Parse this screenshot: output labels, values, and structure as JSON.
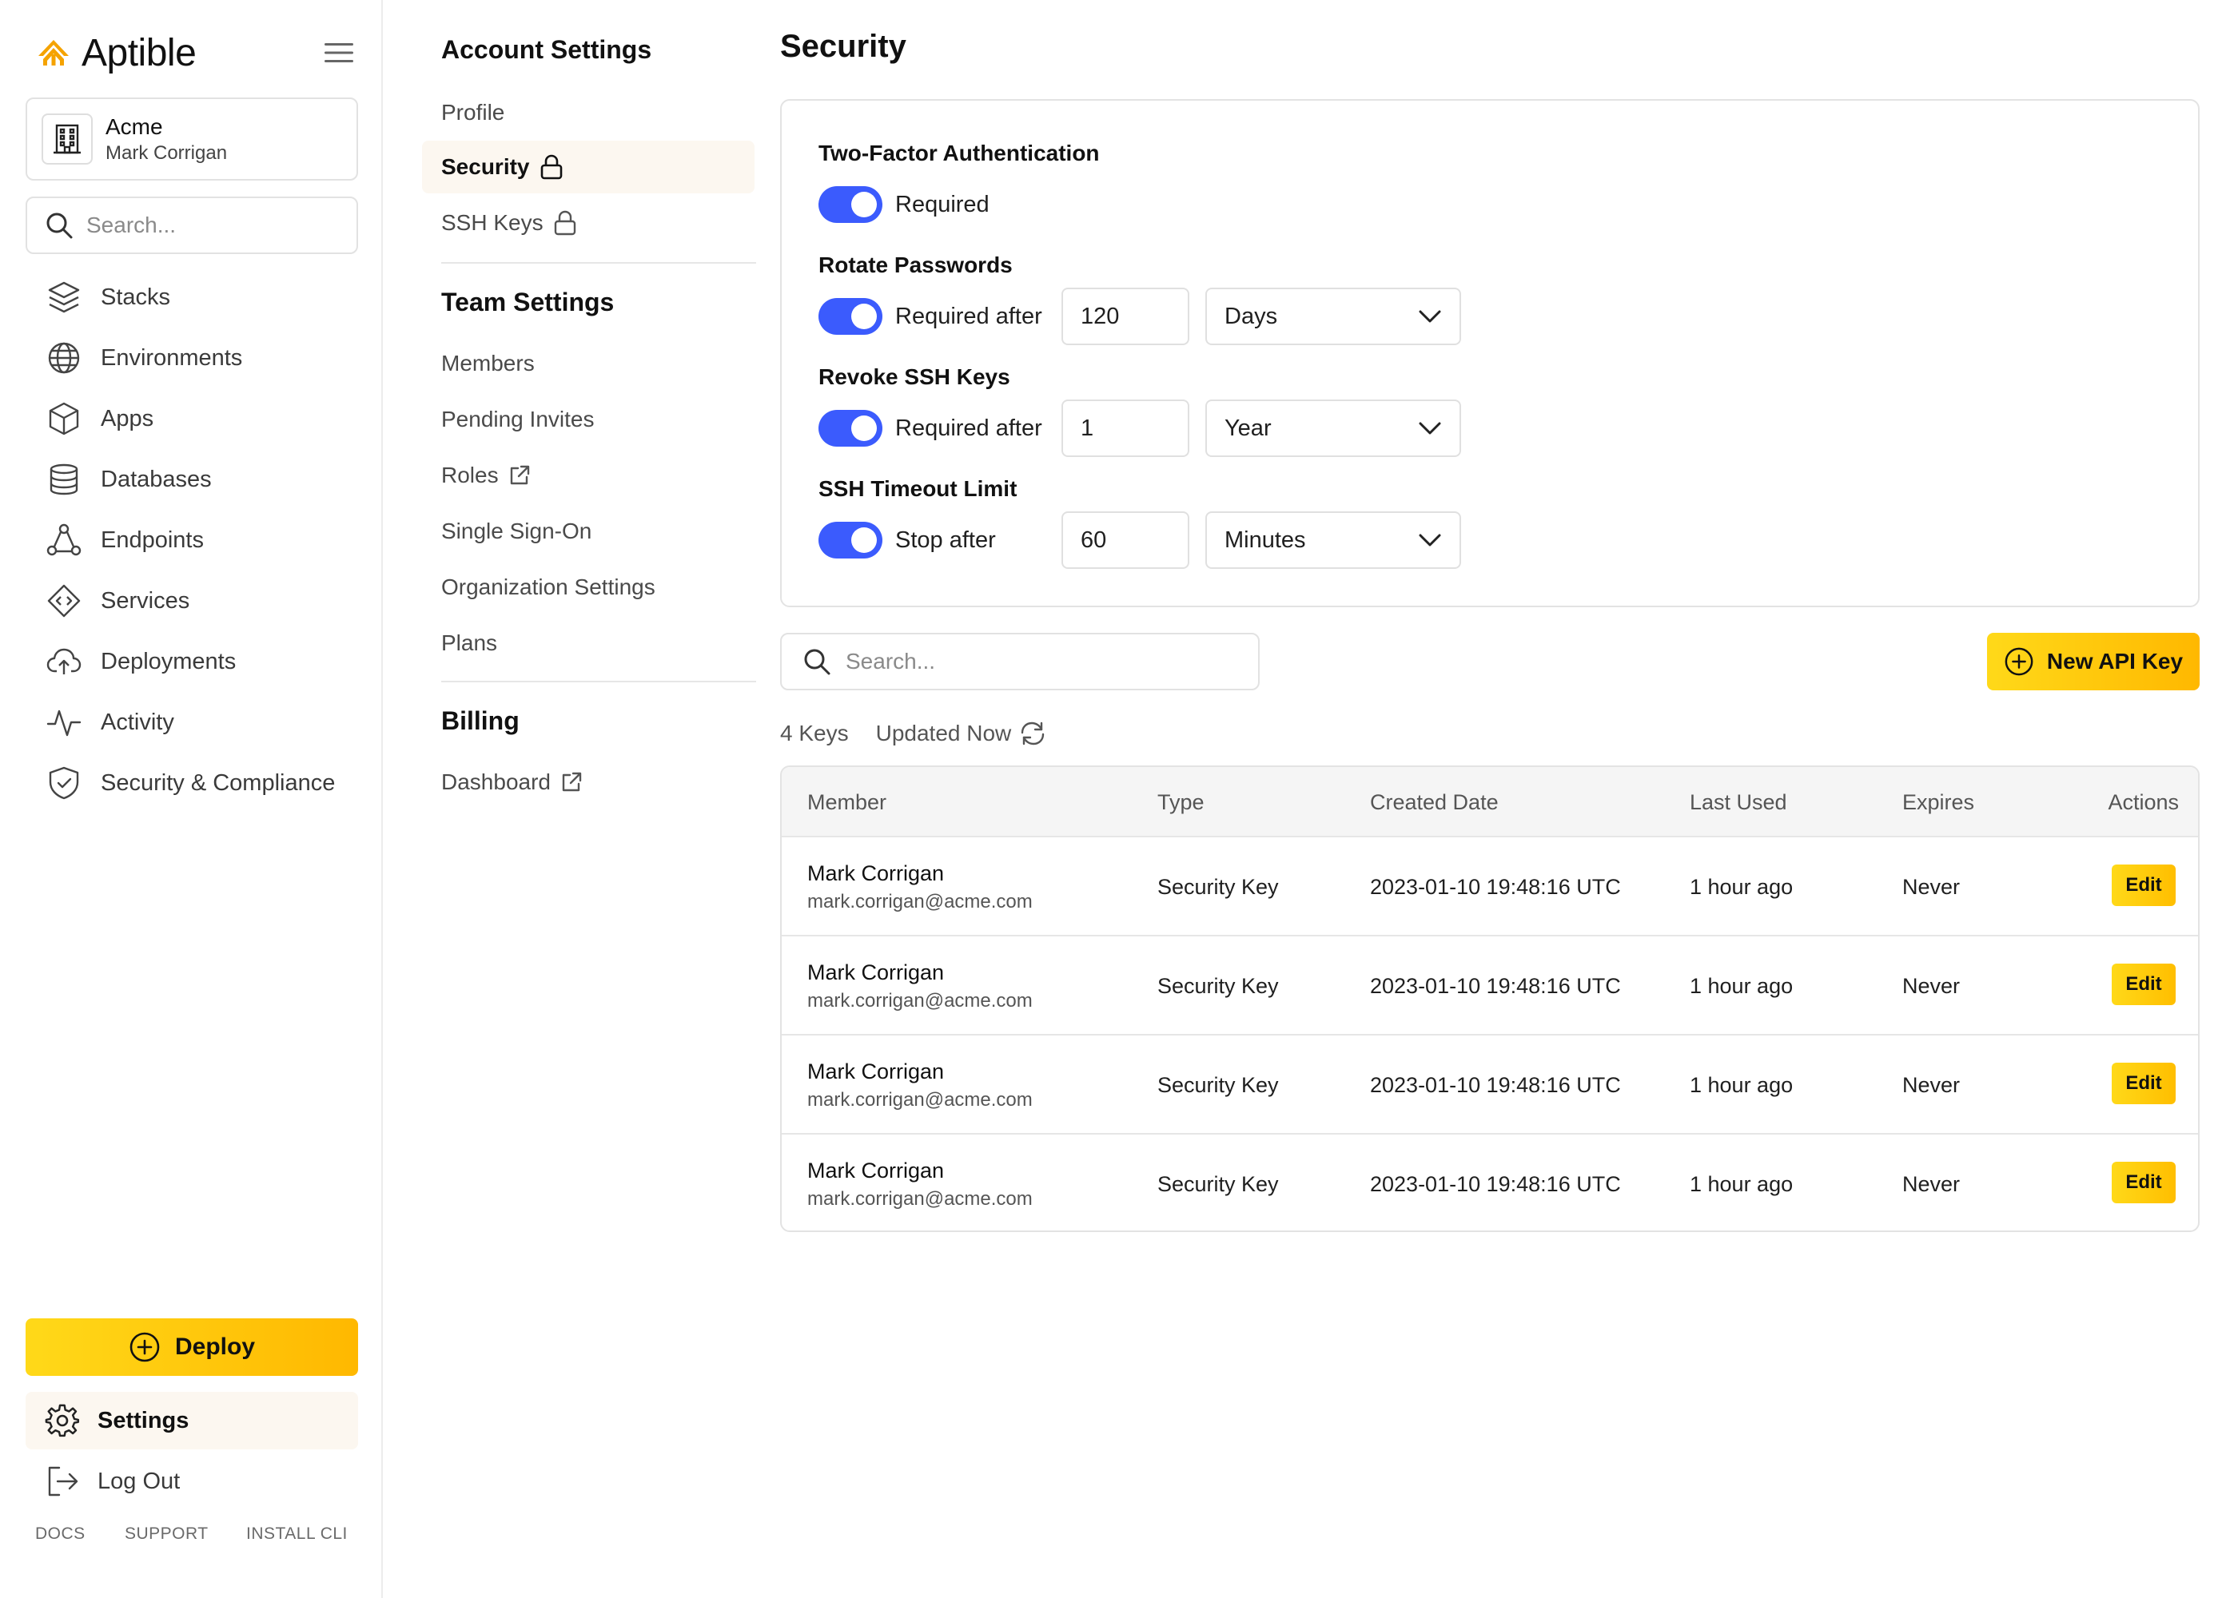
{
  "brand": {
    "name": "Aptible",
    "accent": "#F5A300"
  },
  "org": {
    "name": "Acme",
    "user": "Mark Corrigan"
  },
  "sidebar_search": {
    "placeholder": "Search..."
  },
  "nav": [
    {
      "label": "Stacks",
      "icon": "layers-icon"
    },
    {
      "label": "Environments",
      "icon": "globe-icon"
    },
    {
      "label": "Apps",
      "icon": "cube-icon"
    },
    {
      "label": "Databases",
      "icon": "database-icon"
    },
    {
      "label": "Endpoints",
      "icon": "network-icon"
    },
    {
      "label": "Services",
      "icon": "code-diamond-icon"
    },
    {
      "label": "Deployments",
      "icon": "cloud-upload-icon"
    },
    {
      "label": "Activity",
      "icon": "pulse-icon"
    },
    {
      "label": "Security & Compliance",
      "icon": "shield-check-icon"
    }
  ],
  "deploy_label": "Deploy",
  "settings_label": "Settings",
  "logout_label": "Log Out",
  "footer_links": [
    "DOCS",
    "SUPPORT",
    "INSTALL CLI"
  ],
  "settings_menu": {
    "account_heading": "Account Settings",
    "account_items": [
      {
        "label": "Profile"
      },
      {
        "label": "Security",
        "active": true,
        "lock": true
      },
      {
        "label": "SSH Keys",
        "lock": true
      }
    ],
    "team_heading": "Team Settings",
    "team_items": [
      {
        "label": "Members"
      },
      {
        "label": "Pending Invites"
      },
      {
        "label": "Roles",
        "external": true
      },
      {
        "label": "Single Sign-On"
      },
      {
        "label": "Organization Settings"
      },
      {
        "label": "Plans"
      }
    ],
    "billing_heading": "Billing",
    "billing_items": [
      {
        "label": "Dashboard",
        "external": true
      }
    ]
  },
  "page_title": "Security",
  "policies": {
    "two_factor": {
      "label": "Two-Factor Authentication",
      "toggle_text": "Required",
      "enabled": true
    },
    "rotate_passwords": {
      "label": "Rotate Passwords",
      "toggle_text": "Required after",
      "value": "120",
      "unit": "Days",
      "enabled": true
    },
    "revoke_ssh": {
      "label": "Revoke SSH Keys",
      "toggle_text": "Required after",
      "value": "1",
      "unit": "Year",
      "enabled": true
    },
    "ssh_timeout": {
      "label": "SSH Timeout Limit",
      "toggle_text": "Stop after",
      "value": "60",
      "unit": "Minutes",
      "enabled": true
    }
  },
  "keys": {
    "search_placeholder": "Search...",
    "new_button": "New API Key",
    "count_text": "4 Keys",
    "updated_text": "Updated Now",
    "columns": [
      "Member",
      "Type",
      "Created Date",
      "Last Used",
      "Expires",
      "Actions"
    ],
    "rows": [
      {
        "name": "Mark Corrigan",
        "email": "mark.corrigan@acme.com",
        "type": "Security Key",
        "created": "2023-01-10 19:48:16 UTC",
        "last_used": "1 hour ago",
        "expires": "Never",
        "action": "Edit"
      },
      {
        "name": "Mark Corrigan",
        "email": "mark.corrigan@acme.com",
        "type": "Security Key",
        "created": "2023-01-10 19:48:16 UTC",
        "last_used": "1 hour ago",
        "expires": "Never",
        "action": "Edit"
      },
      {
        "name": "Mark Corrigan",
        "email": "mark.corrigan@acme.com",
        "type": "Security Key",
        "created": "2023-01-10 19:48:16 UTC",
        "last_used": "1 hour ago",
        "expires": "Never",
        "action": "Edit"
      },
      {
        "name": "Mark Corrigan",
        "email": "mark.corrigan@acme.com",
        "type": "Security Key",
        "created": "2023-01-10 19:48:16 UTC",
        "last_used": "1 hour ago",
        "expires": "Never",
        "action": "Edit"
      }
    ]
  },
  "colors": {
    "toggle_on": "#3B5BFD",
    "button_yellow": "#FFD919",
    "button_orange": "#FFB800",
    "active_bg": "#FCF7F0"
  }
}
